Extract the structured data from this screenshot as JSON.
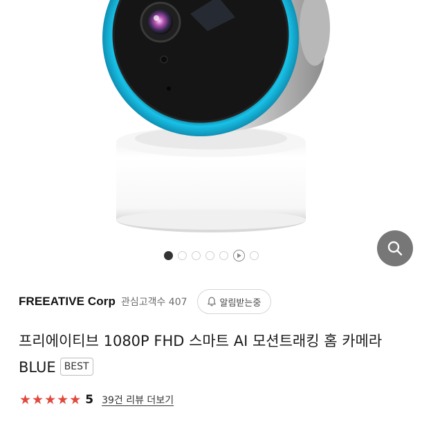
{
  "gallery": {
    "image_icon": "home-security-camera-image",
    "dots": [
      {
        "state": "active"
      },
      {
        "state": "inactive"
      },
      {
        "state": "inactive"
      },
      {
        "state": "inactive"
      },
      {
        "state": "inactive"
      },
      {
        "state": "video"
      },
      {
        "state": "inactive"
      }
    ]
  },
  "search_button": {
    "icon": "search-icon"
  },
  "seller": {
    "name": "FREEATIVE Corp",
    "followers": "관심고객수 407",
    "alarm_label": "알림받는중",
    "alarm_icon": "bell-icon"
  },
  "product": {
    "title": "프리에이티브 1080P FHD 스마트 AI 모션트래킹 홈 카메라 BLUE",
    "badge": "BEST"
  },
  "rating": {
    "stars": 5,
    "score": "5",
    "review_link": "39건 리뷰 더보기"
  },
  "colors": {
    "star": "#e0483c",
    "search_button_bg": "#777777",
    "camera_ring": "#19b8e0"
  }
}
